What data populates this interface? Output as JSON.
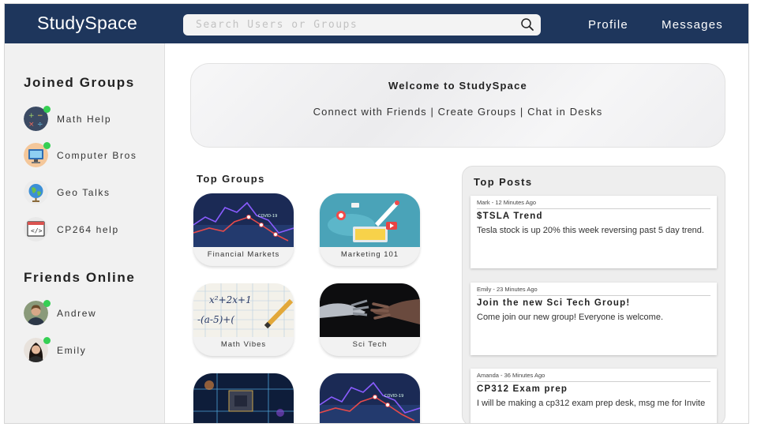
{
  "header": {
    "brand": "StudySpace",
    "search_placeholder": "Search Users or Groups",
    "nav": [
      "Profile",
      "Messages"
    ]
  },
  "sidebar": {
    "joined_title": "Joined Groups",
    "groups": [
      {
        "label": "Math Help",
        "icon": "math-symbols-icon",
        "online": true
      },
      {
        "label": "Computer Bros",
        "icon": "computer-icon",
        "online": true
      },
      {
        "label": "Geo Talks",
        "icon": "globe-icon",
        "online": false
      },
      {
        "label": "CP264 help",
        "icon": "code-window-icon",
        "online": false
      }
    ],
    "friends_title": "Friends Online",
    "friends": [
      {
        "label": "Andrew",
        "online": true
      },
      {
        "label": "Emily",
        "online": true
      }
    ]
  },
  "welcome": {
    "title": "Welcome to StudySpace",
    "subtitle": "Connect with Friends | Create Groups | Chat in Desks"
  },
  "top_groups": {
    "title": "Top Groups",
    "cards": [
      {
        "label": "Financial Markets",
        "image": "stock-chart-image"
      },
      {
        "label": "Marketing 101",
        "image": "marketing-illustration-image"
      },
      {
        "label": "Math Vibes",
        "image": "math-paper-image"
      },
      {
        "label": "Sci Tech",
        "image": "robot-hand-image"
      },
      {
        "label": "",
        "image": "circuit-chip-image"
      },
      {
        "label": "",
        "image": "stock-chart-image"
      }
    ]
  },
  "top_posts": {
    "title": "Top Posts",
    "posts": [
      {
        "meta": "Mark - 12 Minutes Ago",
        "title": "$TSLA Trend",
        "body": "Tesla stock is up 20% this week reversing past 5 day trend."
      },
      {
        "meta": "Emily - 23 Minutes Ago",
        "title": "Join the new Sci Tech Group!",
        "body": "Come join our new group! Everyone is welcome."
      },
      {
        "meta": "Amanda - 36 Minutes Ago",
        "title": "CP312 Exam prep",
        "body": "I will be making a cp312 exam prep desk, msg me for Invite"
      }
    ]
  },
  "colors": {
    "header_bg": "#1e365c",
    "online_dot": "#35cf53",
    "sidebar_bg": "#f1f1f1"
  }
}
